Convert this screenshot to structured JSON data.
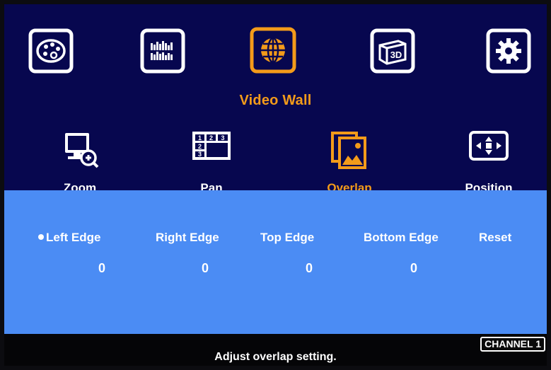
{
  "top_menu": {
    "selected_title": "Video Wall",
    "items": [
      {
        "icon": "palette-icon"
      },
      {
        "icon": "equalizer-icon"
      },
      {
        "icon": "globe-icon",
        "selected": true
      },
      {
        "icon": "3d-icon"
      },
      {
        "icon": "gear-icon"
      }
    ]
  },
  "submenu": {
    "items": [
      {
        "label": "Zoom",
        "icon": "zoom-icon"
      },
      {
        "label": "Pan",
        "icon": "pan-grid-icon"
      },
      {
        "label": "Overlap",
        "icon": "overlap-icon",
        "selected": true
      },
      {
        "label": "Position",
        "icon": "position-icon"
      }
    ]
  },
  "panel": {
    "options": [
      {
        "label": "Left Edge",
        "value": "0",
        "selected": true
      },
      {
        "label": "Right Edge",
        "value": "0"
      },
      {
        "label": "Top Edge",
        "value": "0"
      },
      {
        "label": "Bottom Edge",
        "value": "0"
      },
      {
        "label": "Reset"
      }
    ]
  },
  "status": {
    "channel": "CHANNEL 1",
    "message": "Adjust overlap setting."
  },
  "colors": {
    "background": "#07074f",
    "accent": "#f39b1a",
    "panel": "#4b8cf4"
  }
}
